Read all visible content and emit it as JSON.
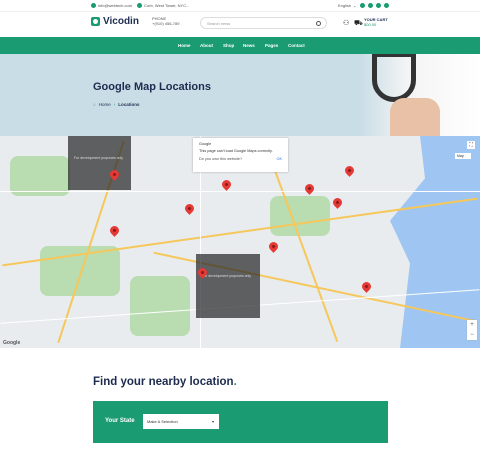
{
  "topbar": {
    "email": "info@webtech.com",
    "address": "Corb, West Tower, NYC...",
    "language": "English",
    "social_icons": [
      "facebook-icon",
      "twitter-icon",
      "vimeo-icon",
      "instagram-icon",
      "linkedin-icon"
    ]
  },
  "header": {
    "logo": "Vicodin",
    "phone_label": "PHONE",
    "phone_number": "+(910) 456-789",
    "search_placeholder": "Search news",
    "cart_label": "YOUR CART",
    "cart_amount": "$00.00"
  },
  "nav": {
    "items": [
      "Home",
      "About",
      "Shop",
      "News",
      "Pages",
      "Contact"
    ]
  },
  "hero": {
    "title": "Google Map Locations",
    "breadcrumb_home": "Home",
    "breadcrumb_current": "Locations"
  },
  "map": {
    "error_title": "Google",
    "error_message": "This page can't load Google Maps correctly.",
    "error_question": "Do you own this website?",
    "error_ok": "OK",
    "dev_watermark": "For development purposes only",
    "map_type": "Map"
  },
  "find": {
    "title": "Find your nearby location",
    "title_dot": ".",
    "state_label": "Your State",
    "state_select_value": "Make A Selection"
  },
  "colors": {
    "brand_green": "#1a9b72",
    "navy": "#1d2b4f",
    "hero_bg": "#c9dde6",
    "pin_red": "#e53935"
  }
}
